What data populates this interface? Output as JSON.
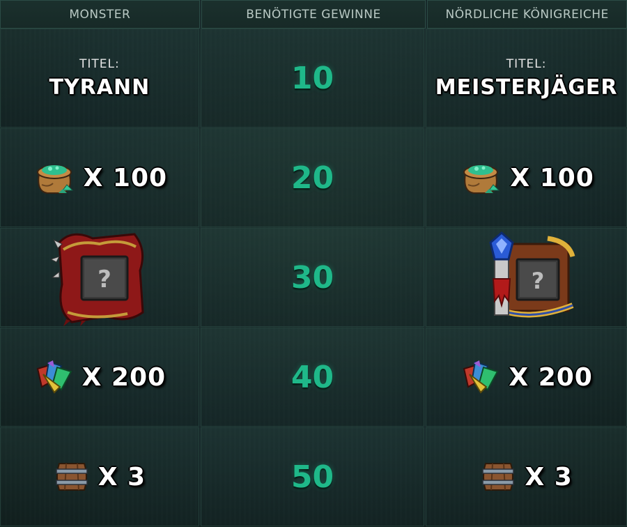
{
  "header": {
    "col1": "MONSTER",
    "col2": "BENÖTIGTE GEWINNE",
    "col3": "NÖRDLICHE KÖNIGREICHE"
  },
  "rows": [
    {
      "wins": "10",
      "left": {
        "type": "title",
        "label": "TITEL:",
        "name": "TYRANN"
      },
      "right": {
        "type": "title",
        "label": "TITEL:",
        "name": "MEISTERJÄGER"
      }
    },
    {
      "wins": "20",
      "left": {
        "type": "reward",
        "icon": "ore-sack-icon",
        "qty": "X 100"
      },
      "right": {
        "type": "reward",
        "icon": "ore-sack-icon",
        "qty": "X 100"
      }
    },
    {
      "wins": "30",
      "left": {
        "type": "frame",
        "icon": "monster-avatar-frame",
        "placeholder": "?"
      },
      "right": {
        "type": "frame",
        "icon": "northern-realms-avatar-frame",
        "placeholder": "?"
      }
    },
    {
      "wins": "40",
      "left": {
        "type": "reward",
        "icon": "card-scraps-icon",
        "qty": "X 200"
      },
      "right": {
        "type": "reward",
        "icon": "card-scraps-icon",
        "qty": "X 200"
      }
    },
    {
      "wins": "50",
      "left": {
        "type": "reward",
        "icon": "keg-icon",
        "qty": "X 3"
      },
      "right": {
        "type": "reward",
        "icon": "keg-icon",
        "qty": "X 3"
      }
    }
  ],
  "colors": {
    "accent": "#1fb889",
    "header_text": "#b9c9c4",
    "background": "#16282a"
  }
}
